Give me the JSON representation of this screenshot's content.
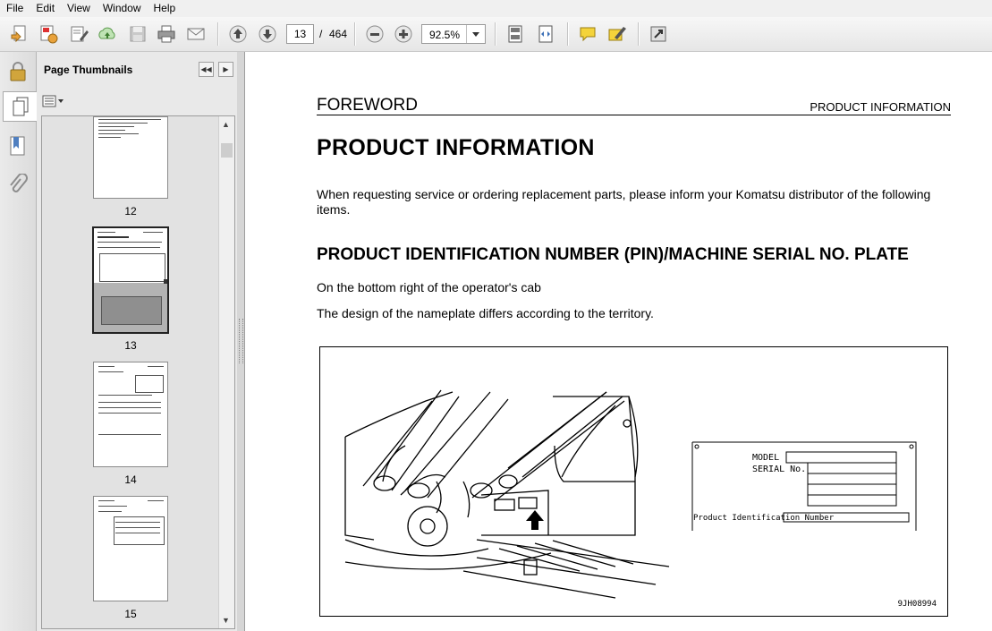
{
  "menu": [
    "File",
    "Edit",
    "View",
    "Window",
    "Help"
  ],
  "toolbar": {
    "page_current": "13",
    "page_separator": "/",
    "page_total": "464",
    "zoom": "92.5%",
    "icons": [
      "create-pdf-icon",
      "convert-icon",
      "edit-icon",
      "upload-icon",
      "save-icon",
      "print-icon",
      "email-icon",
      "prev-page-icon",
      "next-page-icon",
      "zoom-out-icon",
      "zoom-in-icon",
      "fit-page-icon",
      "fit-width-icon",
      "comment-icon",
      "highlight-icon",
      "fullscreen-icon"
    ]
  },
  "sidebar": {
    "title": "Page Thumbnails",
    "thumbnails": [
      {
        "label": "12"
      },
      {
        "label": "13",
        "selected": true
      },
      {
        "label": "14"
      },
      {
        "label": "15"
      }
    ]
  },
  "document": {
    "header_left": "FOREWORD",
    "header_right": "PRODUCT INFORMATION",
    "title": "PRODUCT INFORMATION",
    "intro": "When requesting service or ordering replacement parts, please inform your Komatsu distributor of the following items.",
    "section_title": "PRODUCT IDENTIFICATION NUMBER (PIN)/MACHINE SERIAL NO. PLATE",
    "location_text": "On the bottom right of the operator's cab",
    "design_text": "The design of the nameplate differs according to the territory.",
    "figure": {
      "plate_model": "MODEL",
      "plate_serial": "SERIAL No.",
      "plate_pin": "Product Identification Number",
      "code": "9JH08994"
    }
  }
}
